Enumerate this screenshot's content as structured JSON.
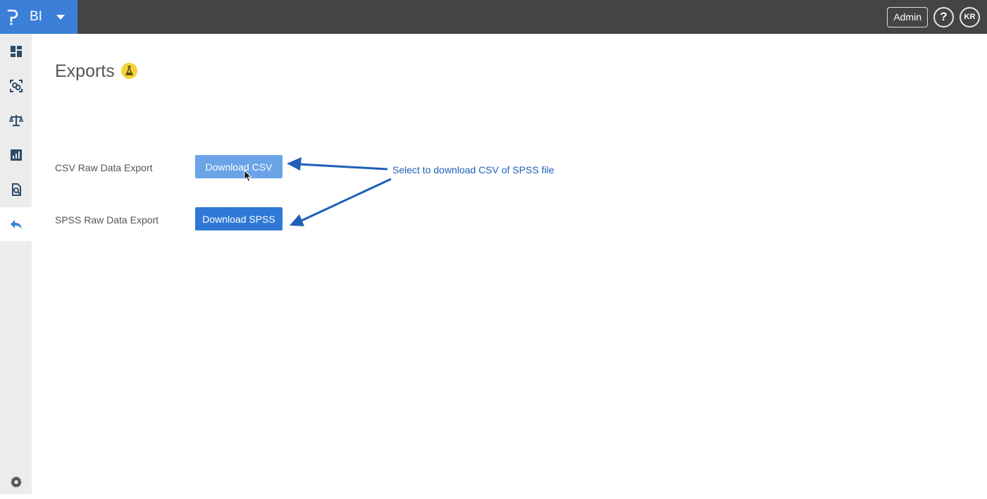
{
  "topbar": {
    "app_name": "BI",
    "admin_label": "Admin",
    "help_label": "?",
    "avatar_initials": "KR",
    "brand_color": "#3b7fd9",
    "bar_color": "#444444"
  },
  "sidebar": {
    "items": [
      {
        "icon": "dashboard-icon",
        "active": false
      },
      {
        "icon": "scan-icon",
        "active": false
      },
      {
        "icon": "balance-scale-icon",
        "active": false
      },
      {
        "icon": "bar-chart-icon",
        "active": false
      },
      {
        "icon": "document-search-icon",
        "active": false
      },
      {
        "icon": "reply-arrow-icon",
        "active": true
      }
    ],
    "settings_icon": "gear-icon"
  },
  "main": {
    "title": "Exports",
    "badge_icon": "flask-icon",
    "rows": [
      {
        "label": "CSV Raw Data Export",
        "button_label": "Download CSV"
      },
      {
        "label": "SPSS Raw Data Export",
        "button_label": "Download SPSS"
      }
    ],
    "annotation": "Select to download CSV of SPSS file"
  }
}
